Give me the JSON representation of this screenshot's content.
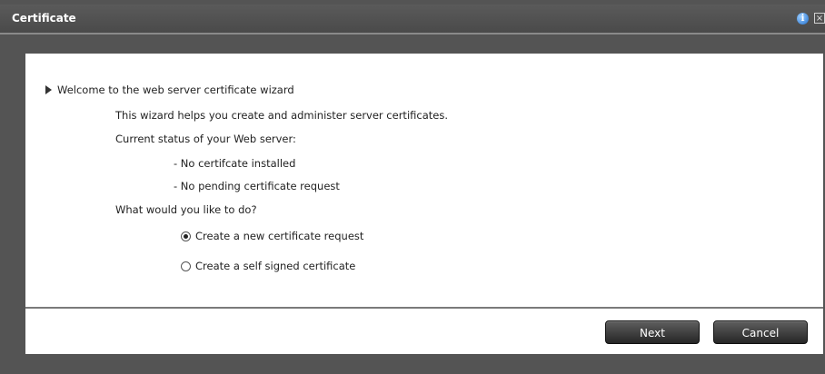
{
  "window": {
    "title": "Certificate",
    "info_icon": "info-icon",
    "info_glyph": "i",
    "close_icon": "close-icon",
    "close_glyph": "×"
  },
  "wizard": {
    "heading": "Welcome to the web server certificate wizard",
    "description": "This wizard helps you create and administer server certificates.",
    "status_label": "Current status of your Web server:",
    "status_items": [
      "- No certifcate installed",
      "- No pending certificate request"
    ],
    "question": "What would you like to do?",
    "options": [
      {
        "label": "Create a new certificate request",
        "selected": true
      },
      {
        "label": "Create a self signed certificate",
        "selected": false
      }
    ]
  },
  "buttons": {
    "next": "Next",
    "cancel": "Cancel"
  },
  "colors": {
    "titlebar": "#4f4f4f",
    "frame": "#545454",
    "content": "#ffffff",
    "button": "#333333"
  }
}
